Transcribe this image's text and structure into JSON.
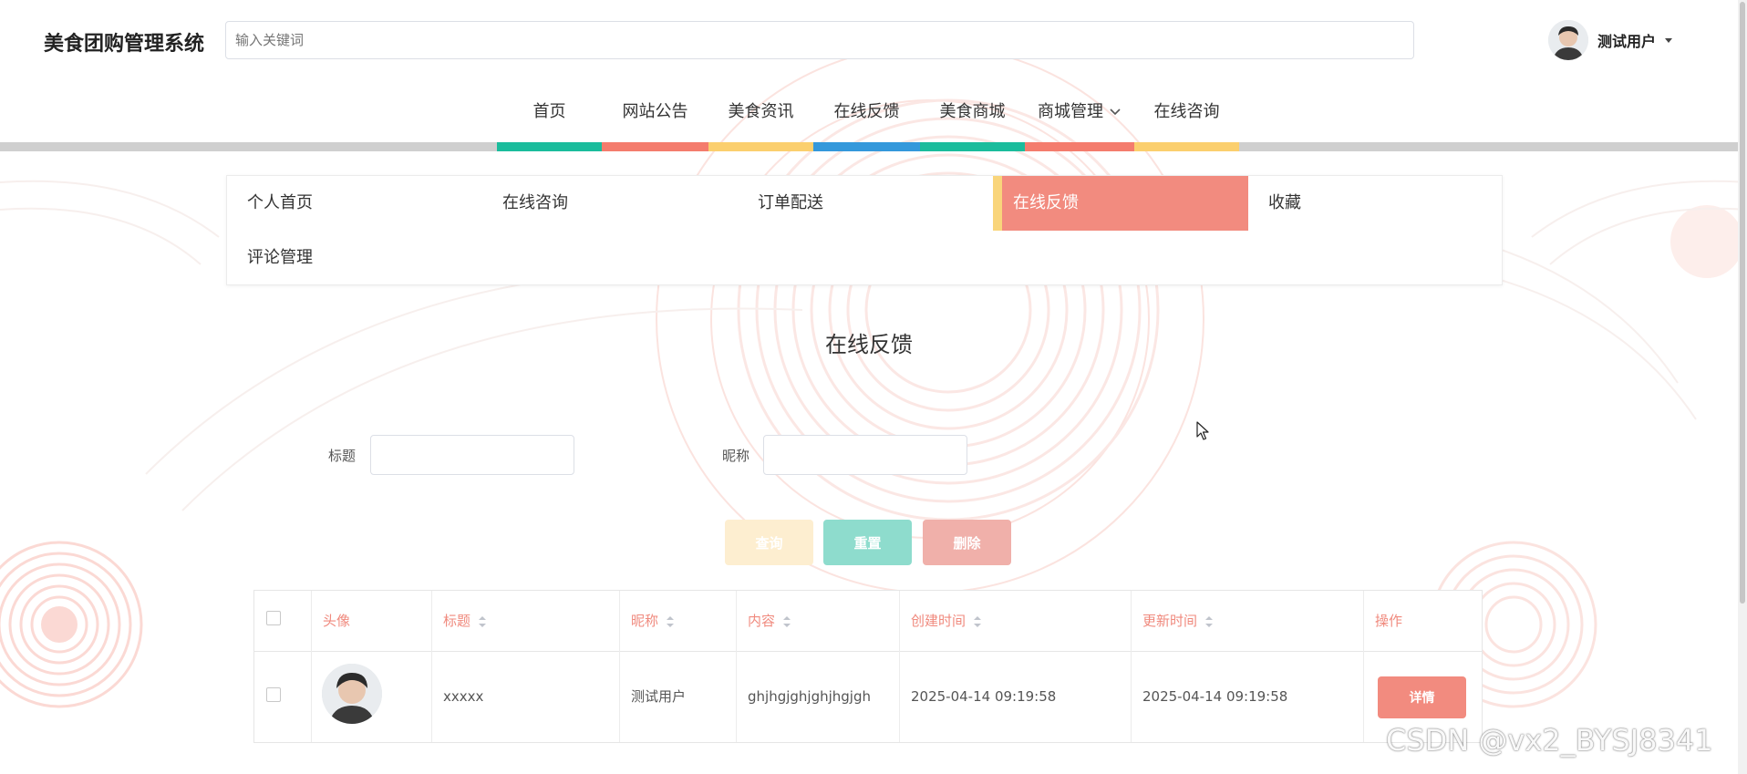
{
  "app": {
    "title": "美食团购管理系统"
  },
  "search": {
    "placeholder": "输入关键词"
  },
  "user": {
    "name": "测试用户"
  },
  "nav": {
    "items": [
      {
        "label": "首页",
        "color": "#1abc9c"
      },
      {
        "label": "网站公告",
        "color": "#f47c6d"
      },
      {
        "label": "美食资讯",
        "color": "#fbcf6e"
      },
      {
        "label": "在线反馈",
        "color": "#3498db"
      },
      {
        "label": "美食商城",
        "color": "#1abc9c"
      },
      {
        "label": "商城管理",
        "color": "#f47c6d"
      },
      {
        "label": "在线咨询",
        "color": "#fbcf6e"
      }
    ]
  },
  "submenu": {
    "items": [
      {
        "label": "个人首页"
      },
      {
        "label": "在线咨询"
      },
      {
        "label": "订单配送"
      },
      {
        "label": "在线反馈",
        "active": true
      },
      {
        "label": "收藏"
      },
      {
        "label": "评论管理"
      }
    ]
  },
  "page": {
    "title": "在线反馈"
  },
  "filters": {
    "title_label": "标题",
    "nickname_label": "昵称"
  },
  "buttons": {
    "query": {
      "label": "查询",
      "color": "#fdeed0"
    },
    "reset": {
      "label": "重置",
      "color": "#8edccd"
    },
    "delete": {
      "label": "删除",
      "color": "#f0b0aa"
    }
  },
  "table": {
    "headers": [
      "头像",
      "标题",
      "昵称",
      "内容",
      "创建时间",
      "更新时间",
      "操作"
    ],
    "rows": [
      {
        "title": "xxxxx",
        "nickname": "测试用户",
        "content": "ghjhgjghjghjhgjgh",
        "created": "2025-04-14 09:19:58",
        "updated": "2025-04-14 09:19:58",
        "action": "详情"
      }
    ]
  },
  "watermark": "CSDN @vx2_BYSJ8341",
  "colors": {
    "accent": "#f28b7f",
    "active_border": "#f9d57b",
    "header_text": "#f08a7e"
  }
}
